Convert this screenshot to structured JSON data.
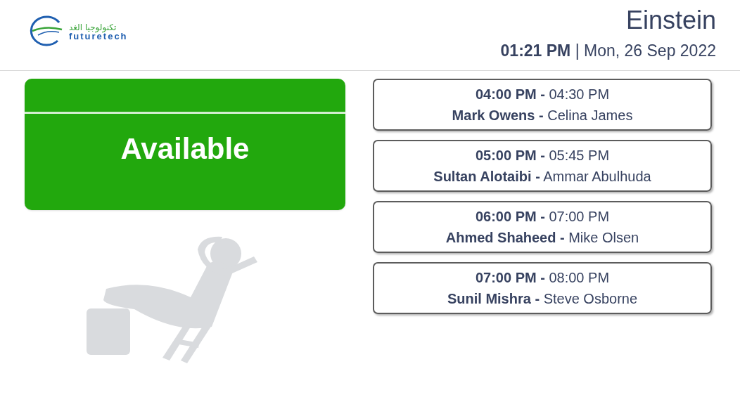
{
  "logo": {
    "arabic": "تكنولوجيا الغد",
    "latin": "futuretech"
  },
  "room": {
    "name": "Einstein",
    "datetime": "**01:21 PM** | Mon, 26 Sep 2022"
  },
  "status": {
    "kind": "available",
    "label": "Available"
  },
  "meetings": [
    {
      "time": "**04:00 PM -** 04:30 PM",
      "people": "**Mark Owens -** Celina James"
    },
    {
      "time": "**05:00 PM -** 05:45 PM",
      "people": "**Sultan Alotaibi -** Ammar Abulhuda"
    },
    {
      "time": "**06:00 PM -** 07:00 PM",
      "people": "**Ahmed Shaheed -** Mike Olsen"
    },
    {
      "time": "**07:00 PM -** 08:00 PM",
      "people": "**Sunil Mishra -** Steve Osborne"
    }
  ]
}
